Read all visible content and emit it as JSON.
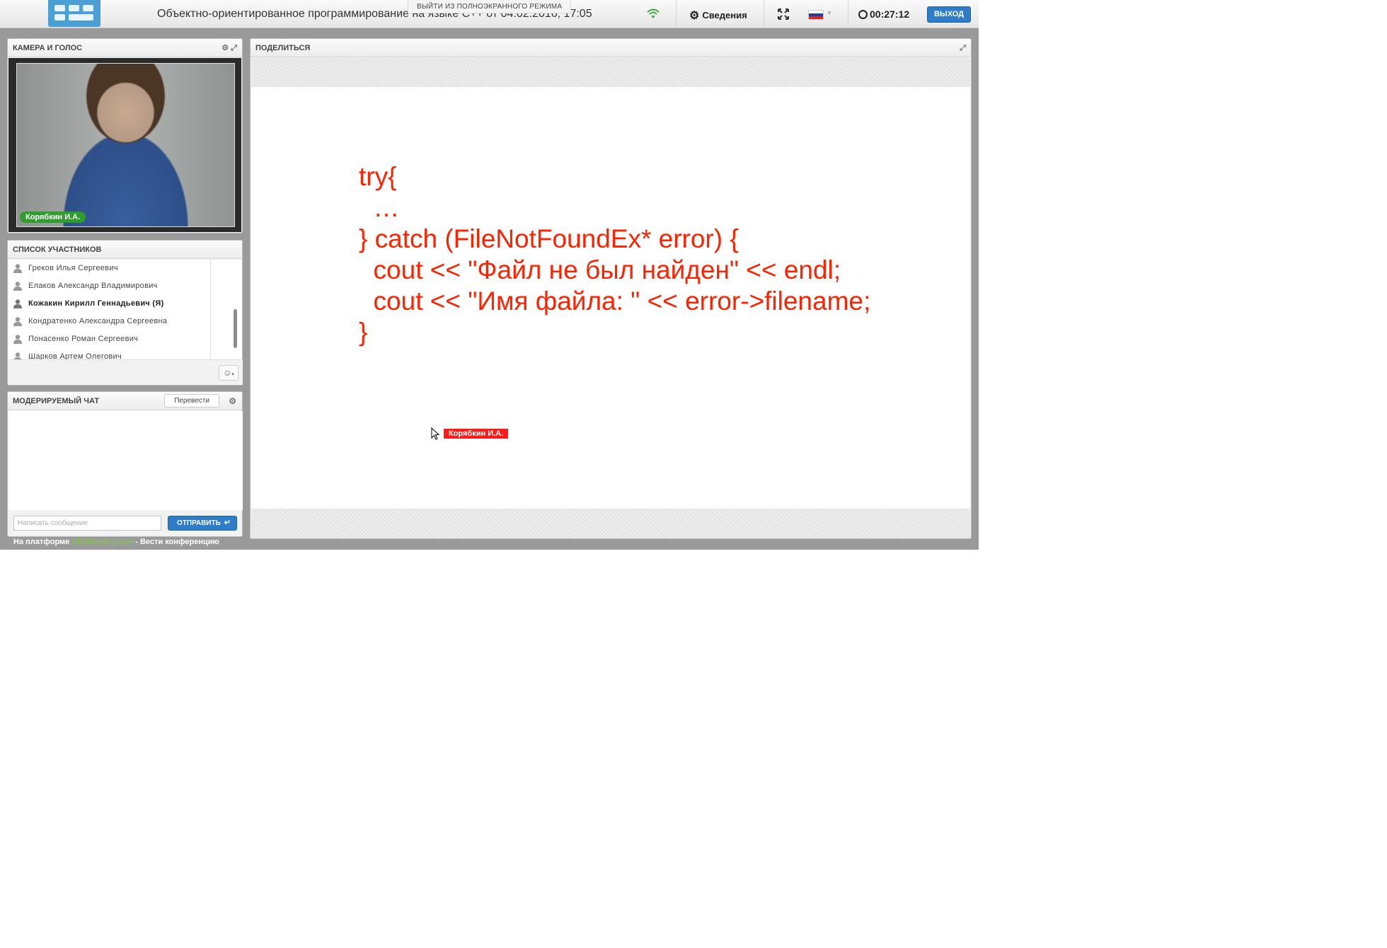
{
  "topbar": {
    "title": "Объектно-ориентированное программирование на языке С++ от 04.02.2016, 17:05",
    "exit_fullscreen": "ВЫЙТИ ИЗ ПОЛНОЭКРАННОГО РЕЖИМА",
    "info_label": "Сведения",
    "timer": "00:27:12",
    "exit_label": "ВЫХОД",
    "flag_colors": [
      "#ffffff",
      "#1c3fa8",
      "#d52b1e"
    ]
  },
  "camera": {
    "title": "КАМЕРА И ГОЛОС",
    "speaker_label": "Корябкин И.А."
  },
  "participants": {
    "title": "СПИСОК УЧАСТНИКОВ",
    "items": [
      "Греков Илья Сергеевич",
      "Елаков Александр Владимирович",
      "Кожакин Кирилл Геннадьевич (Я)",
      "Кондратенко Александра Сергеевна",
      "Понасенко Роман Сергеевич",
      "Шарков Артем Олегович"
    ]
  },
  "chat": {
    "title": "МОДЕРИРУЕМЫЙ ЧАТ",
    "translate_label": "Перевести",
    "input_placeholder": "Написать сообщение",
    "send_label": "ОТПРАВИТЬ"
  },
  "footer": {
    "prefix": "На платформе",
    "brand": "ClickMeeting.com",
    "suffix": "- Вести конференцию"
  },
  "share": {
    "title": "ПОДЕЛИТЬСЯ",
    "code_lines": [
      "try{",
      "  …",
      "} catch (FileNotFoundEx* error) {",
      "  cout << \"Файл не был найден\" << endl;",
      "  cout << \"Имя файла: \" << error->filename;",
      "}"
    ],
    "presenter_tag": "Корябкин И.А."
  },
  "colors": {
    "accent_blue": "#2f7cc8",
    "code_red": "#ff2200",
    "presenter_red": "#ff1a1a",
    "speaker_green": "#2e9d2e",
    "brand_green": "#7bd23b"
  }
}
